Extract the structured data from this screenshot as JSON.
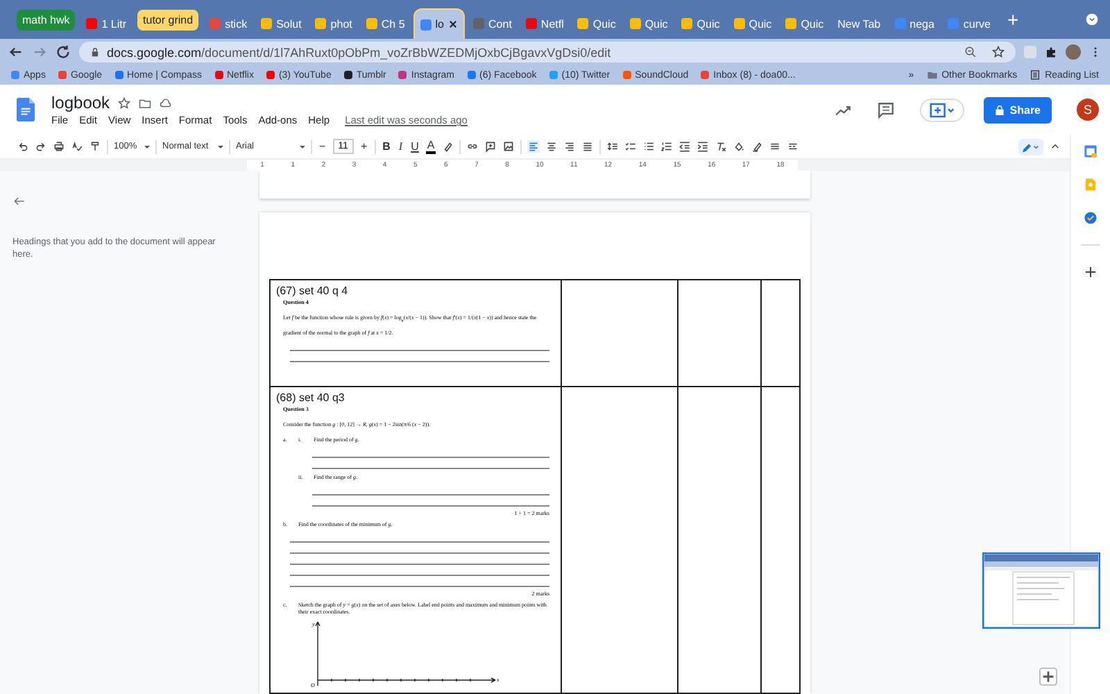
{
  "browser": {
    "tabs": [
      {
        "kind": "group",
        "label": "math hwk",
        "color": "#1e8e3e"
      },
      {
        "kind": "tab",
        "label": "1 Litr",
        "color": "#ff0000",
        "selected": false
      },
      {
        "kind": "group",
        "label": "tutor grind",
        "color": "#fdd663"
      },
      {
        "kind": "tab",
        "label": "stick",
        "color": "#e8453c",
        "selected": false
      },
      {
        "kind": "tab",
        "label": "Solut",
        "color": "#fbbc04",
        "selected": false
      },
      {
        "kind": "tab",
        "label": "phot",
        "color": "#fbbc04",
        "selected": false
      },
      {
        "kind": "tab",
        "label": "Ch 5",
        "color": "#fbbc04",
        "selected": false
      },
      {
        "kind": "tab",
        "label": "lo",
        "color": "#4285f4",
        "selected": true
      },
      {
        "kind": "tab",
        "label": "Cont",
        "color": "#5f6368",
        "selected": false
      },
      {
        "kind": "tab",
        "label": "Netfl",
        "color": "#e50914",
        "selected": false
      },
      {
        "kind": "tab",
        "label": "Quic",
        "color": "#fbbc04",
        "selected": false
      },
      {
        "kind": "tab",
        "label": "Quic",
        "color": "#fbbc04",
        "selected": false
      },
      {
        "kind": "tab",
        "label": "Quic",
        "color": "#fbbc04",
        "selected": false
      },
      {
        "kind": "tab",
        "label": "Quic",
        "color": "#fbbc04",
        "selected": false
      },
      {
        "kind": "tab",
        "label": "Quic",
        "color": "#fbbc04",
        "selected": false
      },
      {
        "kind": "tab",
        "label": "New Tab",
        "selected": false
      },
      {
        "kind": "tab",
        "label": "nega",
        "color": "#4285f4",
        "selected": false
      },
      {
        "kind": "tab",
        "label": "curve",
        "color": "#4285f4",
        "selected": false
      }
    ],
    "new_tab_button": "+",
    "url_host": "docs.google.com",
    "url_path": "/document/d/1l7AhRuxt0pObPm_voZrBbWZEDMjOxbCjBgavxVgDsi0/edit",
    "bookmarks": [
      {
        "label": "Apps",
        "color": "#4285f4"
      },
      {
        "label": "Google",
        "color": "#ea4335"
      },
      {
        "label": "Home | Compass",
        "color": "#1a73e8"
      },
      {
        "label": "Netflix",
        "color": "#e50914"
      },
      {
        "label": "(3) YouTube",
        "color": "#ff0000"
      },
      {
        "label": "Tumblr",
        "color": "#202124"
      },
      {
        "label": "Instagram",
        "color": "#c13584"
      },
      {
        "label": "(6) Facebook",
        "color": "#1877f2"
      },
      {
        "label": "(10) Twitter",
        "color": "#1da1f2"
      },
      {
        "label": "SoundCloud",
        "color": "#ff5500"
      },
      {
        "label": "Inbox (8) - doa00...",
        "color": "#ea4335"
      }
    ],
    "bookmarks_more": "»",
    "other_bookmarks": "Other Bookmarks",
    "reading_list": "Reading List"
  },
  "docs": {
    "title": "logbook",
    "menus": [
      "File",
      "Edit",
      "View",
      "Insert",
      "Format",
      "Tools",
      "Add-ons",
      "Help"
    ],
    "last_edit": "Last edit was seconds ago",
    "share": "Share",
    "avatar": "S"
  },
  "toolbar": {
    "zoom": "100%",
    "style": "Normal text",
    "font": "Arial",
    "size_minus": "−",
    "font_size": "11",
    "size_plus": "+",
    "format": [
      "B",
      "I",
      "U",
      "A"
    ],
    "alignment": [
      {
        "selected": true
      },
      {
        "selected": false
      },
      {
        "selected": false
      },
      {
        "selected": false
      }
    ]
  },
  "ruler": [
    "1",
    "1",
    "2",
    "3",
    "4",
    "5",
    "6",
    "7",
    "8",
    "10",
    "11",
    "12",
    "14",
    "15",
    "16",
    "17",
    "18"
  ],
  "outline": {
    "hint": "Headings that you add to the document will appear here."
  },
  "table": {
    "rows": [
      {
        "parts": [
          {
            "kind": "heading",
            "text": "(67) set 40 q 4"
          },
          {
            "kind": "label",
            "text": "Question 4"
          },
          {
            "kind": "para",
            "text": "Let *f* be the function whose rule is given by *f*(*x*) = log$_{e}$(*x*/(*x* − 1)). Show that *f*′(*x*) = 1/(*x*(1 − *x*)) and hence state the gradient of the normal to the graph of *f* at *x* = 1/2."
          },
          {
            "kind": "answer_line"
          },
          {
            "kind": "answer_line"
          }
        ]
      },
      {
        "parts": [
          {
            "kind": "heading",
            "text": "(68) set 40 q3"
          },
          {
            "kind": "label",
            "text": "Question 3"
          },
          {
            "kind": "para",
            "text": "Consider the function *g* : [0, 12] → *R*, *g*(*x*) = 1 − 2sin(π/6 (*x* − 2))."
          },
          {
            "kind": "item",
            "marker": "a.",
            "submarker": "i.",
            "text": "Find the period of *g*."
          },
          {
            "kind": "sub_answer_line"
          },
          {
            "kind": "sub_answer_line"
          },
          {
            "kind": "item",
            "submarker": "ii.",
            "text": "Find the range of *g*."
          },
          {
            "kind": "sub_answer_line"
          },
          {
            "kind": "sub_answer_line"
          },
          {
            "kind": "marks",
            "text": "1 + 1 = 2 marks"
          },
          {
            "kind": "item",
            "marker": "b.",
            "text": "Find the coordinates of the minimum of *g*."
          },
          {
            "kind": "answer_line"
          },
          {
            "kind": "answer_line"
          },
          {
            "kind": "answer_line"
          },
          {
            "kind": "answer_line"
          },
          {
            "kind": "answer_line"
          },
          {
            "kind": "marks",
            "text": "2 marks"
          },
          {
            "kind": "item",
            "marker": "c.",
            "text": "Sketch the graph of *y* = *g*(*x*) on the set of axes below. Label end points and maximum and minimum points with their exact coordinates."
          },
          {
            "kind": "axes",
            "y": "y",
            "origin": "O",
            "x": "x"
          }
        ]
      }
    ]
  }
}
